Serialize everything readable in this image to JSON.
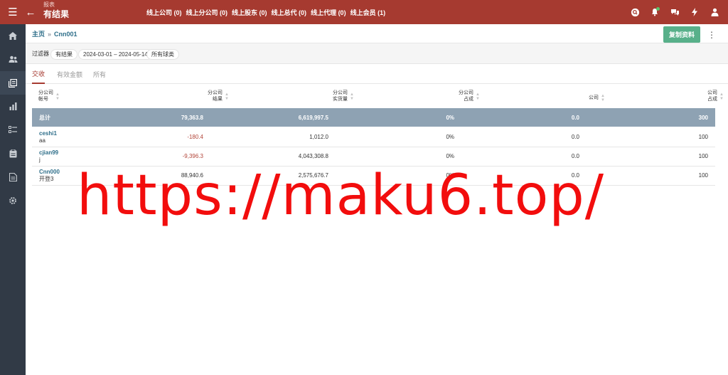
{
  "header": {
    "subtitle": "报表",
    "title": "有结果",
    "links": [
      "线上公司 (0)",
      "线上分公司 (0)",
      "线上股东 (0)",
      "线上总代 (0)",
      "线上代理 (0)",
      "线上会员 (1)"
    ],
    "icons": [
      "search-icon",
      "bell-icon",
      "chat-icon",
      "bolt-icon",
      "user-icon"
    ],
    "accent_color": "#a63a30",
    "notification_color": "#58c36a"
  },
  "sidebar": {
    "items": [
      "home-icon",
      "users-icon",
      "report-icon",
      "chart-icon",
      "list-icon",
      "clipboard-icon",
      "document-icon",
      "settings-icon"
    ],
    "active_index": 2
  },
  "breadcrumb": {
    "home": "主页",
    "separator": "»",
    "current": "Cnn001"
  },
  "actions": {
    "copy_label": "复制资料"
  },
  "filters": {
    "label": "过滤器",
    "status": "有结果",
    "date_range": "2024-03-01 – 2024-05-14",
    "sport": "所有球类"
  },
  "tabs": [
    {
      "label": "交收",
      "active": true
    },
    {
      "label": "有效金额",
      "active": false
    },
    {
      "label": "所有",
      "active": false
    }
  ],
  "table": {
    "columns": [
      {
        "line1": "分公司",
        "line2": "帐号"
      },
      {
        "line1": "分公司",
        "line2": "结果"
      },
      {
        "line1": "分公司",
        "line2": "实货量"
      },
      {
        "line1": "分公司",
        "line2": "占成"
      },
      {
        "line1": "公司",
        "line2": ""
      },
      {
        "line1": "公司",
        "line2": "占成"
      }
    ],
    "total": {
      "label": "总计",
      "result": "79,363.8",
      "volume": "6,619,997.5",
      "share": "0%",
      "company": "0.0",
      "company_share": "300"
    },
    "rows": [
      {
        "account": "ceshi1",
        "name": "aa",
        "result": "-180.4",
        "volume": "1,012.0",
        "share": "0%",
        "company": "0.0",
        "company_share": "100"
      },
      {
        "account": "cjian99",
        "name": "j",
        "result": "-9,396.3",
        "volume": "4,043,308.8",
        "share": "0%",
        "company": "0.0",
        "company_share": "100"
      },
      {
        "account": "Cnn000",
        "name": "开登3",
        "result": "88,940.6",
        "volume": "2,575,676.7",
        "share": "0%",
        "company": "0.0",
        "company_share": "100"
      }
    ]
  },
  "watermark": "https://maku6.top/"
}
